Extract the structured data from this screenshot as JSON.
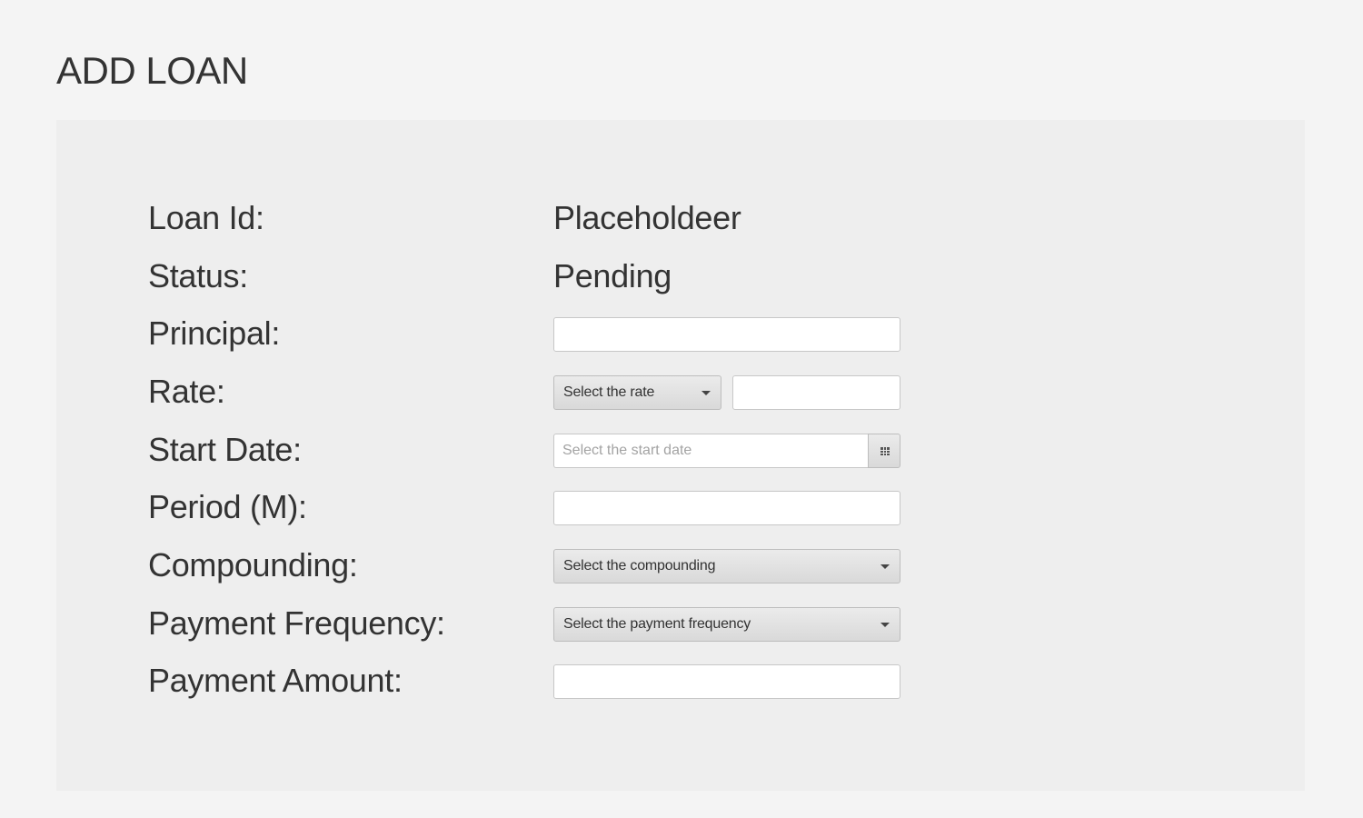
{
  "page": {
    "title": "ADD LOAN"
  },
  "form": {
    "loan_id": {
      "label": "Loan Id:",
      "value": "Placeholdeer"
    },
    "status": {
      "label": "Status:",
      "value": "Pending"
    },
    "principal": {
      "label": "Principal:",
      "value": "",
      "placeholder": ""
    },
    "rate": {
      "label": "Rate:",
      "select_text": "Select the rate",
      "value": ""
    },
    "start_date": {
      "label": "Start Date:",
      "value": "",
      "placeholder": "Select the start date",
      "icon": "calendar-icon"
    },
    "period": {
      "label": "Period (M):",
      "value": ""
    },
    "compounding": {
      "label": "Compounding:",
      "select_text": "Select the compounding"
    },
    "payment_frequency": {
      "label": "Payment Frequency:",
      "select_text": "Select the payment frequency"
    },
    "payment_amount": {
      "label": "Payment Amount:",
      "value": ""
    }
  },
  "icons": {
    "dropdown": "chevron-down-icon",
    "calendar": "calendar-icon"
  },
  "colors": {
    "page_background": "#f4f4f4",
    "panel_background": "#eeeeee",
    "text": "#333333",
    "input_border": "#c7c7c7",
    "placeholder": "#a3a3a3"
  }
}
